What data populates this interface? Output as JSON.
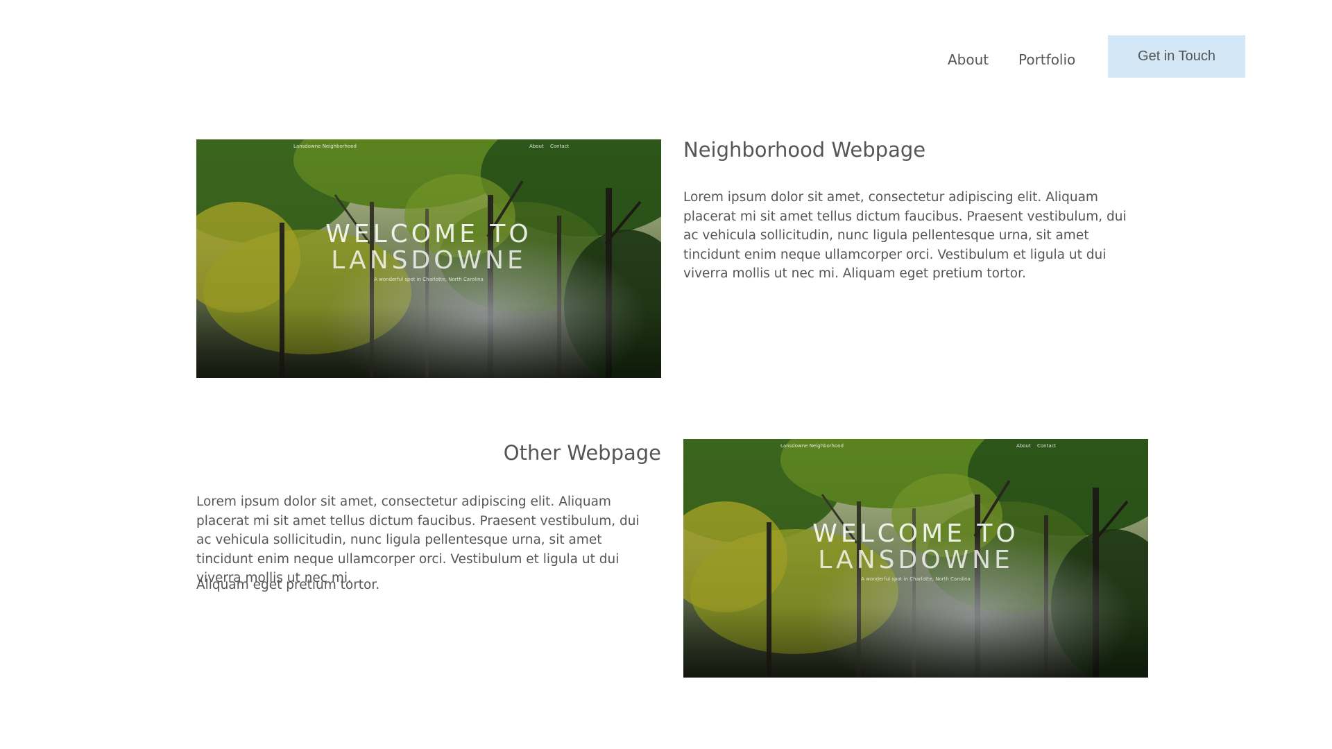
{
  "nav": {
    "about": "About",
    "portfolio": "Portfolio",
    "cta": "Get in Touch"
  },
  "thumbnail": {
    "brand": "Lansdowne Neighborhood",
    "link_1": "About",
    "link_2": "Contact",
    "heading_line1": "WELCOME TO",
    "heading_line2": "LANSDOWNE",
    "subtitle": "A wonderful spot in Charlotte, North Carolina"
  },
  "projects": [
    {
      "title": "Neighborhood Webpage",
      "description": "Lorem ipsum dolor sit amet, consectetur adipiscing elit. Aliquam placerat mi sit amet tellus dictum faucibus. Praesent vestibulum, dui ac vehicula sollicitudin, nunc ligula pellentesque urna, sit amet tincidunt enim neque ullamcorper orci. Vestibulum et ligula ut dui viverra mollis ut nec mi. Aliquam eget pretium tortor."
    },
    {
      "title": "Other Webpage",
      "description": "Lorem ipsum dolor sit amet, consectetur adipiscing elit. Aliquam placerat mi sit amet tellus dictum faucibus. Praesent vestibulum, dui ac vehicula sollicitudin, nunc ligula pellentesque urna, sit amet tincidunt enim neque ullamcorper orci. Vestibulum et ligula ut dui viverra mollis ut nec mi.",
      "description_tail": "Aliquam eget pretium tortor."
    }
  ],
  "colors": {
    "cta_background": "#d3e7f6",
    "text": "#555555"
  }
}
